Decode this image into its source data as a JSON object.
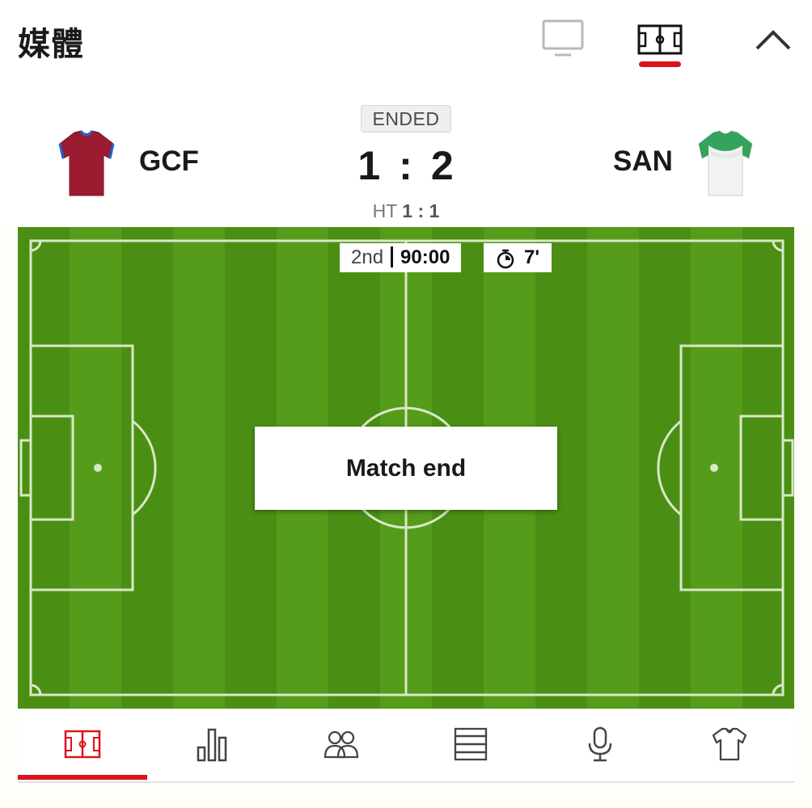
{
  "header": {
    "title": "媒體",
    "icons": [
      "tv-icon",
      "pitch-icon",
      "chevron-up-icon"
    ],
    "active_color": "#d9141e"
  },
  "match": {
    "status": "ENDED",
    "home": {
      "name": "GCF",
      "jersey_color": "#9b1b30",
      "jersey_trim": "#1e63d6"
    },
    "away": {
      "name": "SAN",
      "jersey_color": "#f2f2f2",
      "jersey_trim": "#1f9a4a"
    },
    "score": {
      "home": "1",
      "separator": ":",
      "away": "2"
    },
    "halftime": {
      "label": "HT",
      "score": "1 : 1"
    }
  },
  "pitch": {
    "half": "2nd",
    "clock": "90:00",
    "added_time": "7'",
    "overlay_text": "Match end",
    "grass_color": "#4a8f14"
  },
  "tabs": [
    {
      "icon": "pitch-icon",
      "active": true
    },
    {
      "icon": "stats-bars-icon",
      "active": false
    },
    {
      "icon": "lineups-icon",
      "active": false
    },
    {
      "icon": "list-icon",
      "active": false
    },
    {
      "icon": "microphone-icon",
      "active": false
    },
    {
      "icon": "jersey-icon",
      "active": false
    }
  ]
}
